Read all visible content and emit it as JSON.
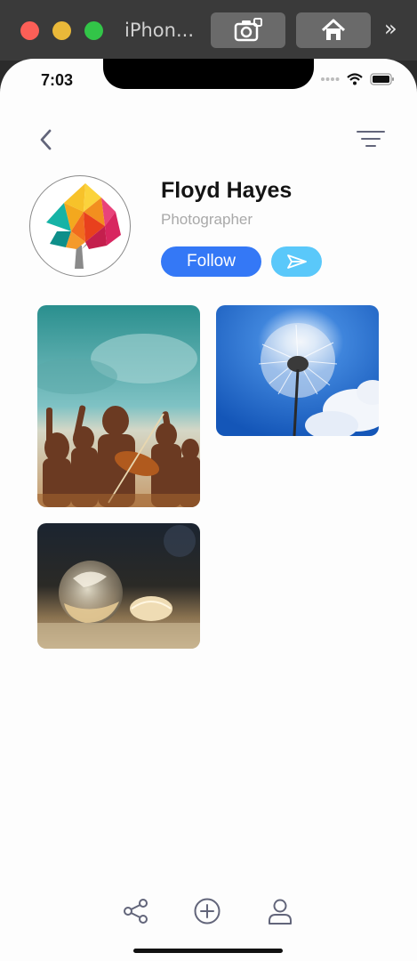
{
  "simulator": {
    "title": "iPhon...",
    "screenshot_icon": "camera-icon",
    "home_icon": "home-icon",
    "more_label": "»"
  },
  "status_bar": {
    "time": "7:03",
    "signal_icon": "signal-dots-icon",
    "wifi_icon": "wifi-icon",
    "battery_icon": "battery-icon"
  },
  "nav": {
    "back_icon": "chevron-left-icon",
    "filter_icon": "filter-icon"
  },
  "profile": {
    "name": "Floyd Hayes",
    "role": "Photographer",
    "follow_label": "Follow",
    "send_icon": "paper-plane-icon",
    "avatar": "low-poly-tree-logo"
  },
  "gallery": [
    {
      "subject": "children-with-violin"
    },
    {
      "subject": "dandelion-blue-sky"
    },
    {
      "subject": "frozen-bubble"
    }
  ],
  "tabbar": {
    "items": [
      {
        "icon": "share-icon"
      },
      {
        "icon": "plus-circle-icon"
      },
      {
        "icon": "user-icon"
      }
    ]
  },
  "colors": {
    "accent": "#3478f6",
    "send": "#5ac8fa",
    "secondary_text": "#a9a9a9"
  }
}
